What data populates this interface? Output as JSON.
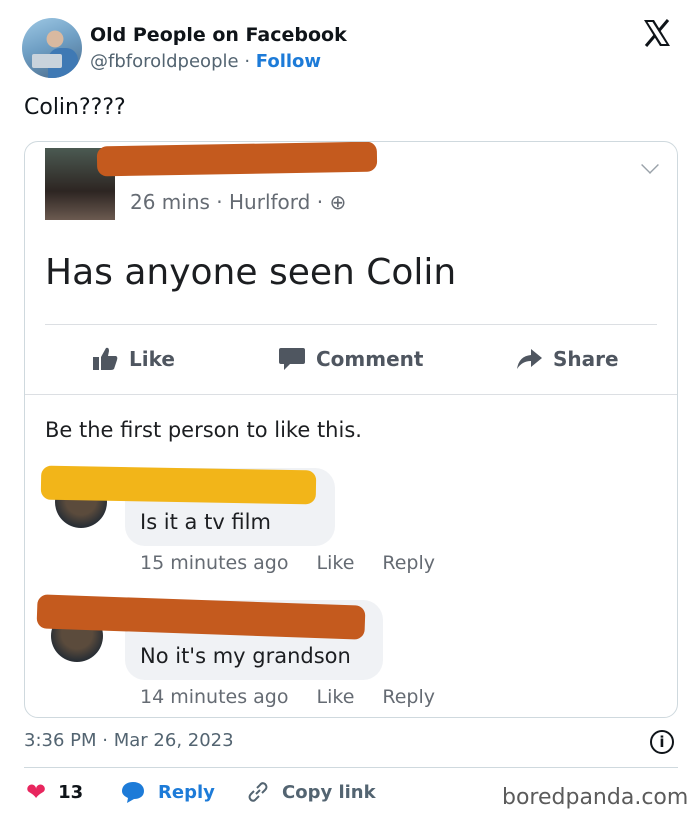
{
  "account": {
    "name": "Old People on Facebook",
    "handle": "@fbforoldpeople",
    "separator": "·",
    "follow_label": "Follow"
  },
  "tweet": {
    "text": "Colin????",
    "time": "3:36 PM",
    "date_separator": "·",
    "date": "Mar 26, 2023",
    "like_count": "13",
    "reply_label": "Reply",
    "copy_label": "Copy link"
  },
  "fb_post": {
    "meta": "26 mins · Hurlford · ",
    "text": "Has anyone seen Colin",
    "actions": {
      "like": "Like",
      "comment": "Comment",
      "share": "Share"
    },
    "likes_line": "Be the first person to like this.",
    "comments": [
      {
        "text": "Is it a tv film",
        "time": "15 minutes ago",
        "like": "Like",
        "reply": "Reply"
      },
      {
        "text": "No it's my grandson",
        "time": "14 minutes ago",
        "like": "Like",
        "reply": "Reply"
      }
    ]
  },
  "watermark": "boredpanda.com",
  "colors": {
    "accent": "#1d7bd8",
    "heart": "#e8265e",
    "redaction_top": "#c45a1e",
    "redaction_yellow": "#f2b519"
  }
}
